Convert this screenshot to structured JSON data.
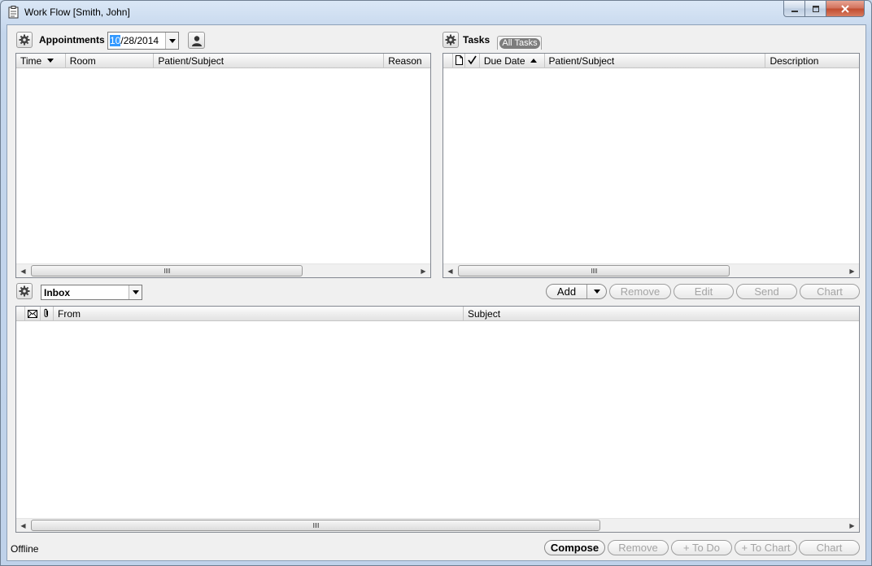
{
  "window": {
    "title": "Work Flow [Smith, John]"
  },
  "appointments": {
    "label": "Appointments",
    "date_selected": "10",
    "date_rest": "/28/2014",
    "columns": [
      "Time",
      "Room",
      "Patient/Subject",
      "Reason"
    ],
    "sort_column": "Time",
    "sort_direction": "descending"
  },
  "tasks": {
    "label": "Tasks",
    "filter": "All Tasks",
    "columns": [
      "Due Date",
      "Patient/Subject",
      "Description"
    ],
    "sort_column": "Due Date",
    "sort_direction": "ascending",
    "buttons": {
      "add": "Add",
      "remove": "Remove",
      "edit": "Edit",
      "send": "Send",
      "chart": "Chart"
    }
  },
  "messages": {
    "folder": "Inbox",
    "columns": [
      "From",
      "Subject"
    ]
  },
  "footer": {
    "status": "Offline",
    "buttons": {
      "compose": "Compose",
      "remove": "Remove",
      "to_do": "+ To Do",
      "to_chart": "+ To Chart",
      "chart": "Chart"
    }
  },
  "colors": {
    "title_bar": "#c4d6ec",
    "close_button": "#c14c2f",
    "selection": "#3399ff",
    "filter_pill": "#7d7d7d"
  }
}
